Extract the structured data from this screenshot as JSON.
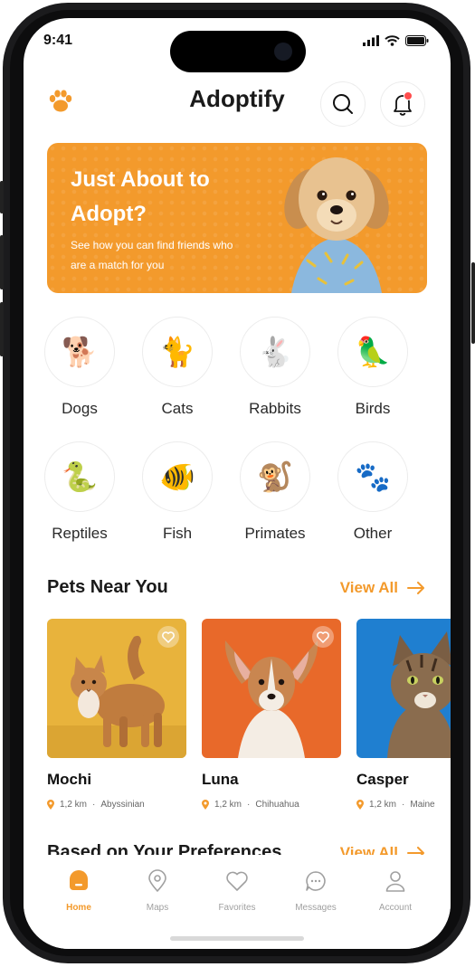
{
  "status": {
    "time": "9:41"
  },
  "header": {
    "title": "Adoptify"
  },
  "banner": {
    "title": "Just About to Adopt?",
    "subtitle": "See how you can find friends who are a match for you"
  },
  "categories": [
    {
      "label": "Dogs",
      "icon": "🐕"
    },
    {
      "label": "Cats",
      "icon": "🐈"
    },
    {
      "label": "Rabbits",
      "icon": "🐇"
    },
    {
      "label": "Birds",
      "icon": "🦜"
    },
    {
      "label": "Reptiles",
      "icon": "🐍"
    },
    {
      "label": "Fish",
      "icon": "🐠"
    },
    {
      "label": "Primates",
      "icon": "🐒"
    },
    {
      "label": "Other",
      "icon": "🐾"
    }
  ],
  "pets_near": {
    "title": "Pets Near You",
    "view_all": "View All",
    "items": [
      {
        "name": "Mochi",
        "distance": "1,2 km",
        "breed": "Abyssinian"
      },
      {
        "name": "Luna",
        "distance": "1,2 km",
        "breed": "Chihuahua"
      },
      {
        "name": "Casper",
        "distance": "1,2 km",
        "breed": "Maine"
      }
    ]
  },
  "preferences": {
    "title": "Based on Your Preferences",
    "view_all": "View All"
  },
  "tabs": [
    {
      "label": "Home",
      "icon": "home-icon",
      "active": true
    },
    {
      "label": "Maps",
      "icon": "map-pin-icon"
    },
    {
      "label": "Favorites",
      "icon": "heart-icon"
    },
    {
      "label": "Messages",
      "icon": "chat-icon"
    },
    {
      "label": "Account",
      "icon": "user-icon"
    }
  ],
  "colors": {
    "accent": "#f39a2c",
    "text": "#1a1a1a",
    "muted": "#a0a0a0"
  }
}
